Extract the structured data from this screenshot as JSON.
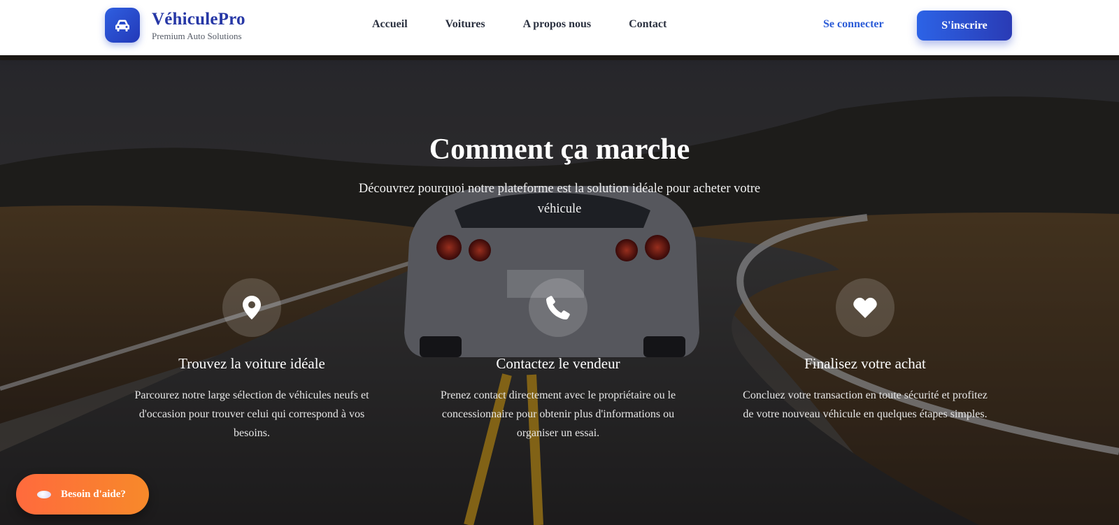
{
  "brand": {
    "name": "VéhiculePro",
    "tagline": "Premium Auto Solutions",
    "logo_icon": "car-icon"
  },
  "nav": {
    "items": [
      {
        "label": "Accueil"
      },
      {
        "label": "Voitures"
      },
      {
        "label": "A propos nous"
      },
      {
        "label": "Contact"
      }
    ]
  },
  "auth": {
    "login_label": "Se connecter",
    "signup_label": "S'inscrire"
  },
  "section": {
    "title": "Comment ça marche",
    "subtitle": "Découvrez pourquoi notre plateforme est la solution idéale pour acheter votre véhicule"
  },
  "features": [
    {
      "icon": "map-pin-icon",
      "title": "Trouvez la voiture idéale",
      "text": "Parcourez notre large sélection de véhicules neufs et d'occasion pour trouver celui qui correspond à vos besoins."
    },
    {
      "icon": "phone-icon",
      "title": "Contactez le vendeur",
      "text": "Prenez contact directement avec le propriétaire ou le concessionnaire pour obtenir plus d'informations ou organiser un essai."
    },
    {
      "icon": "heart-icon",
      "title": "Finalisez votre achat",
      "text": "Concluez votre transaction en toute sécurité et profitez de votre nouveau véhicule en quelques étapes simples."
    }
  ],
  "help": {
    "label": "Besoin d'aide?",
    "icon": "chat-bubble-icon"
  },
  "colors": {
    "brand_primary": "#2738a6",
    "accent_blue": "#2a5bd7",
    "help_orange": "#ff6a3d"
  }
}
